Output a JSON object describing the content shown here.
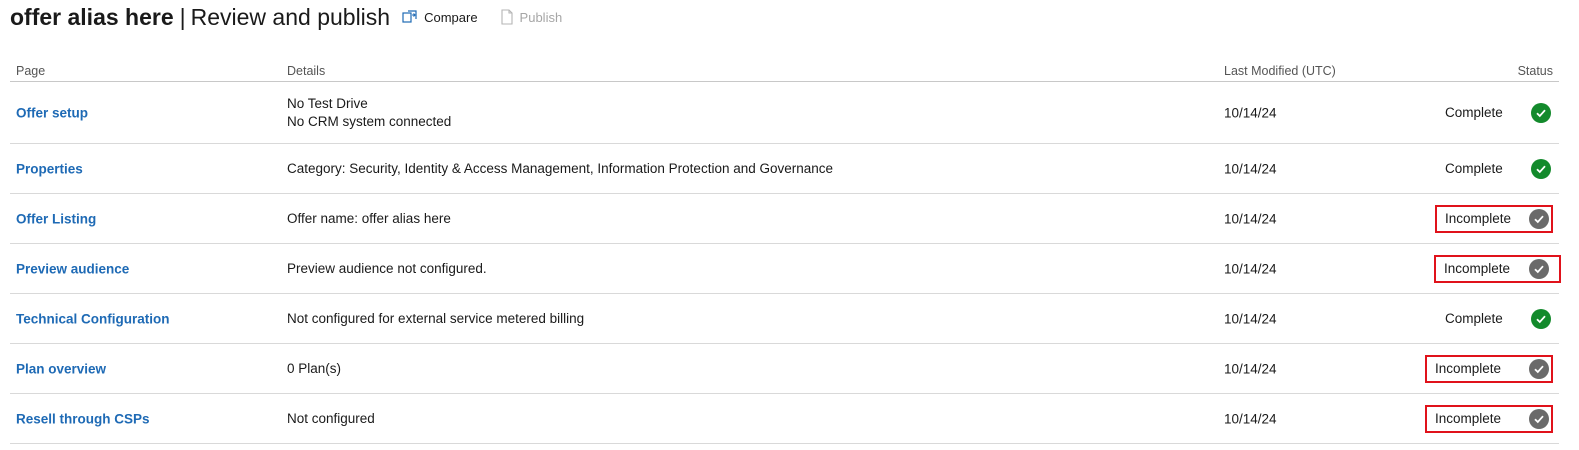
{
  "header": {
    "offer_alias": "offer alias here",
    "separator": "|",
    "title": "Review and publish",
    "compare_label": "Compare",
    "publish_label": "Publish"
  },
  "table": {
    "columns": {
      "page": "Page",
      "details": "Details",
      "last_modified": "Last Modified (UTC)",
      "status": "Status"
    },
    "rows": [
      {
        "page": "Offer setup",
        "details": [
          "No Test Drive",
          "No CRM system connected"
        ],
        "last_modified": "10/14/24",
        "status": "Complete"
      },
      {
        "page": "Properties",
        "details": [
          "Category: Security, Identity & Access Management, Information Protection and Governance"
        ],
        "last_modified": "10/14/24",
        "status": "Complete"
      },
      {
        "page": "Offer Listing",
        "details": [
          "Offer name: offer alias here"
        ],
        "last_modified": "10/14/24",
        "status": "Incomplete"
      },
      {
        "page": "Preview audience",
        "details": [
          "Preview audience not configured."
        ],
        "last_modified": "10/14/24",
        "status": "Incomplete"
      },
      {
        "page": "Technical Configuration",
        "details": [
          "Not configured for external service metered billing"
        ],
        "last_modified": "10/14/24",
        "status": "Complete"
      },
      {
        "page": "Plan overview",
        "details": [
          "0 Plan(s)"
        ],
        "last_modified": "10/14/24",
        "status": "Incomplete"
      },
      {
        "page": "Resell through CSPs",
        "details": [
          "Not configured"
        ],
        "last_modified": "10/14/24",
        "status": "Incomplete"
      }
    ]
  },
  "colors": {
    "link": "#1e6ab5",
    "complete": "#138a2c",
    "incomplete": "#6a6a6a",
    "highlight": "#e0121b"
  },
  "icons": {
    "compare": "compare-icon",
    "publish": "publish-icon",
    "complete": "check-circle-icon",
    "incomplete": "check-circle-gray-icon"
  }
}
